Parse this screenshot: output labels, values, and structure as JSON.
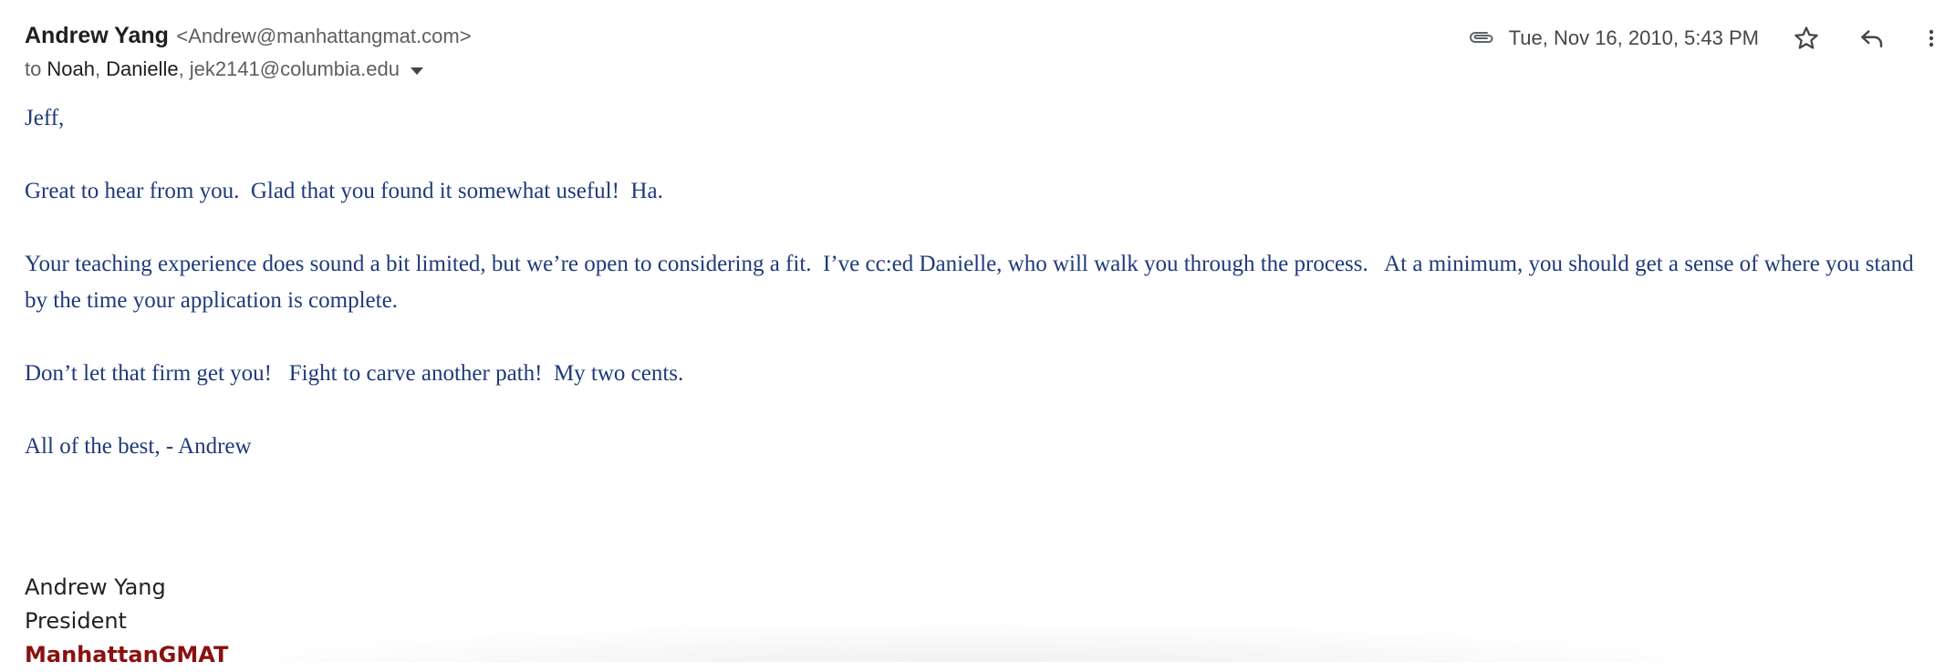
{
  "header": {
    "sender_name": "Andrew Yang",
    "sender_email": "<Andrew@manhattangmat.com>",
    "to_prefix": "to",
    "recipients": [
      "Noah",
      "Danielle"
    ],
    "recipient_email": "jek2141@columbia.edu",
    "date": "Tue, Nov 16, 2010, 5:43 PM",
    "icons": {
      "attachment": "paperclip-icon",
      "star": "star-icon",
      "reply": "reply-icon",
      "more": "more-vert-icon",
      "details": "chevron-down-icon"
    }
  },
  "message": {
    "greeting": "Jeff,",
    "paragraphs": [
      "Great to hear from you.  Glad that you found it somewhat useful!  Ha.",
      "Your teaching experience does sound a bit limited, but we’re open to considering a fit.  I’ve cc:ed Danielle, who will walk you through the process.   At a minimum, you should get a sense of where you stand by the time your application is complete.",
      "Don’t let that firm get you!   Fight to carve another path!  My two cents.",
      "All of the best, - Andrew"
    ]
  },
  "signature": {
    "name": "Andrew Yang",
    "title": "President",
    "company": "ManhattanGMAT"
  },
  "colors": {
    "body_text": "#1f3a7a",
    "company": "#8b1010"
  }
}
